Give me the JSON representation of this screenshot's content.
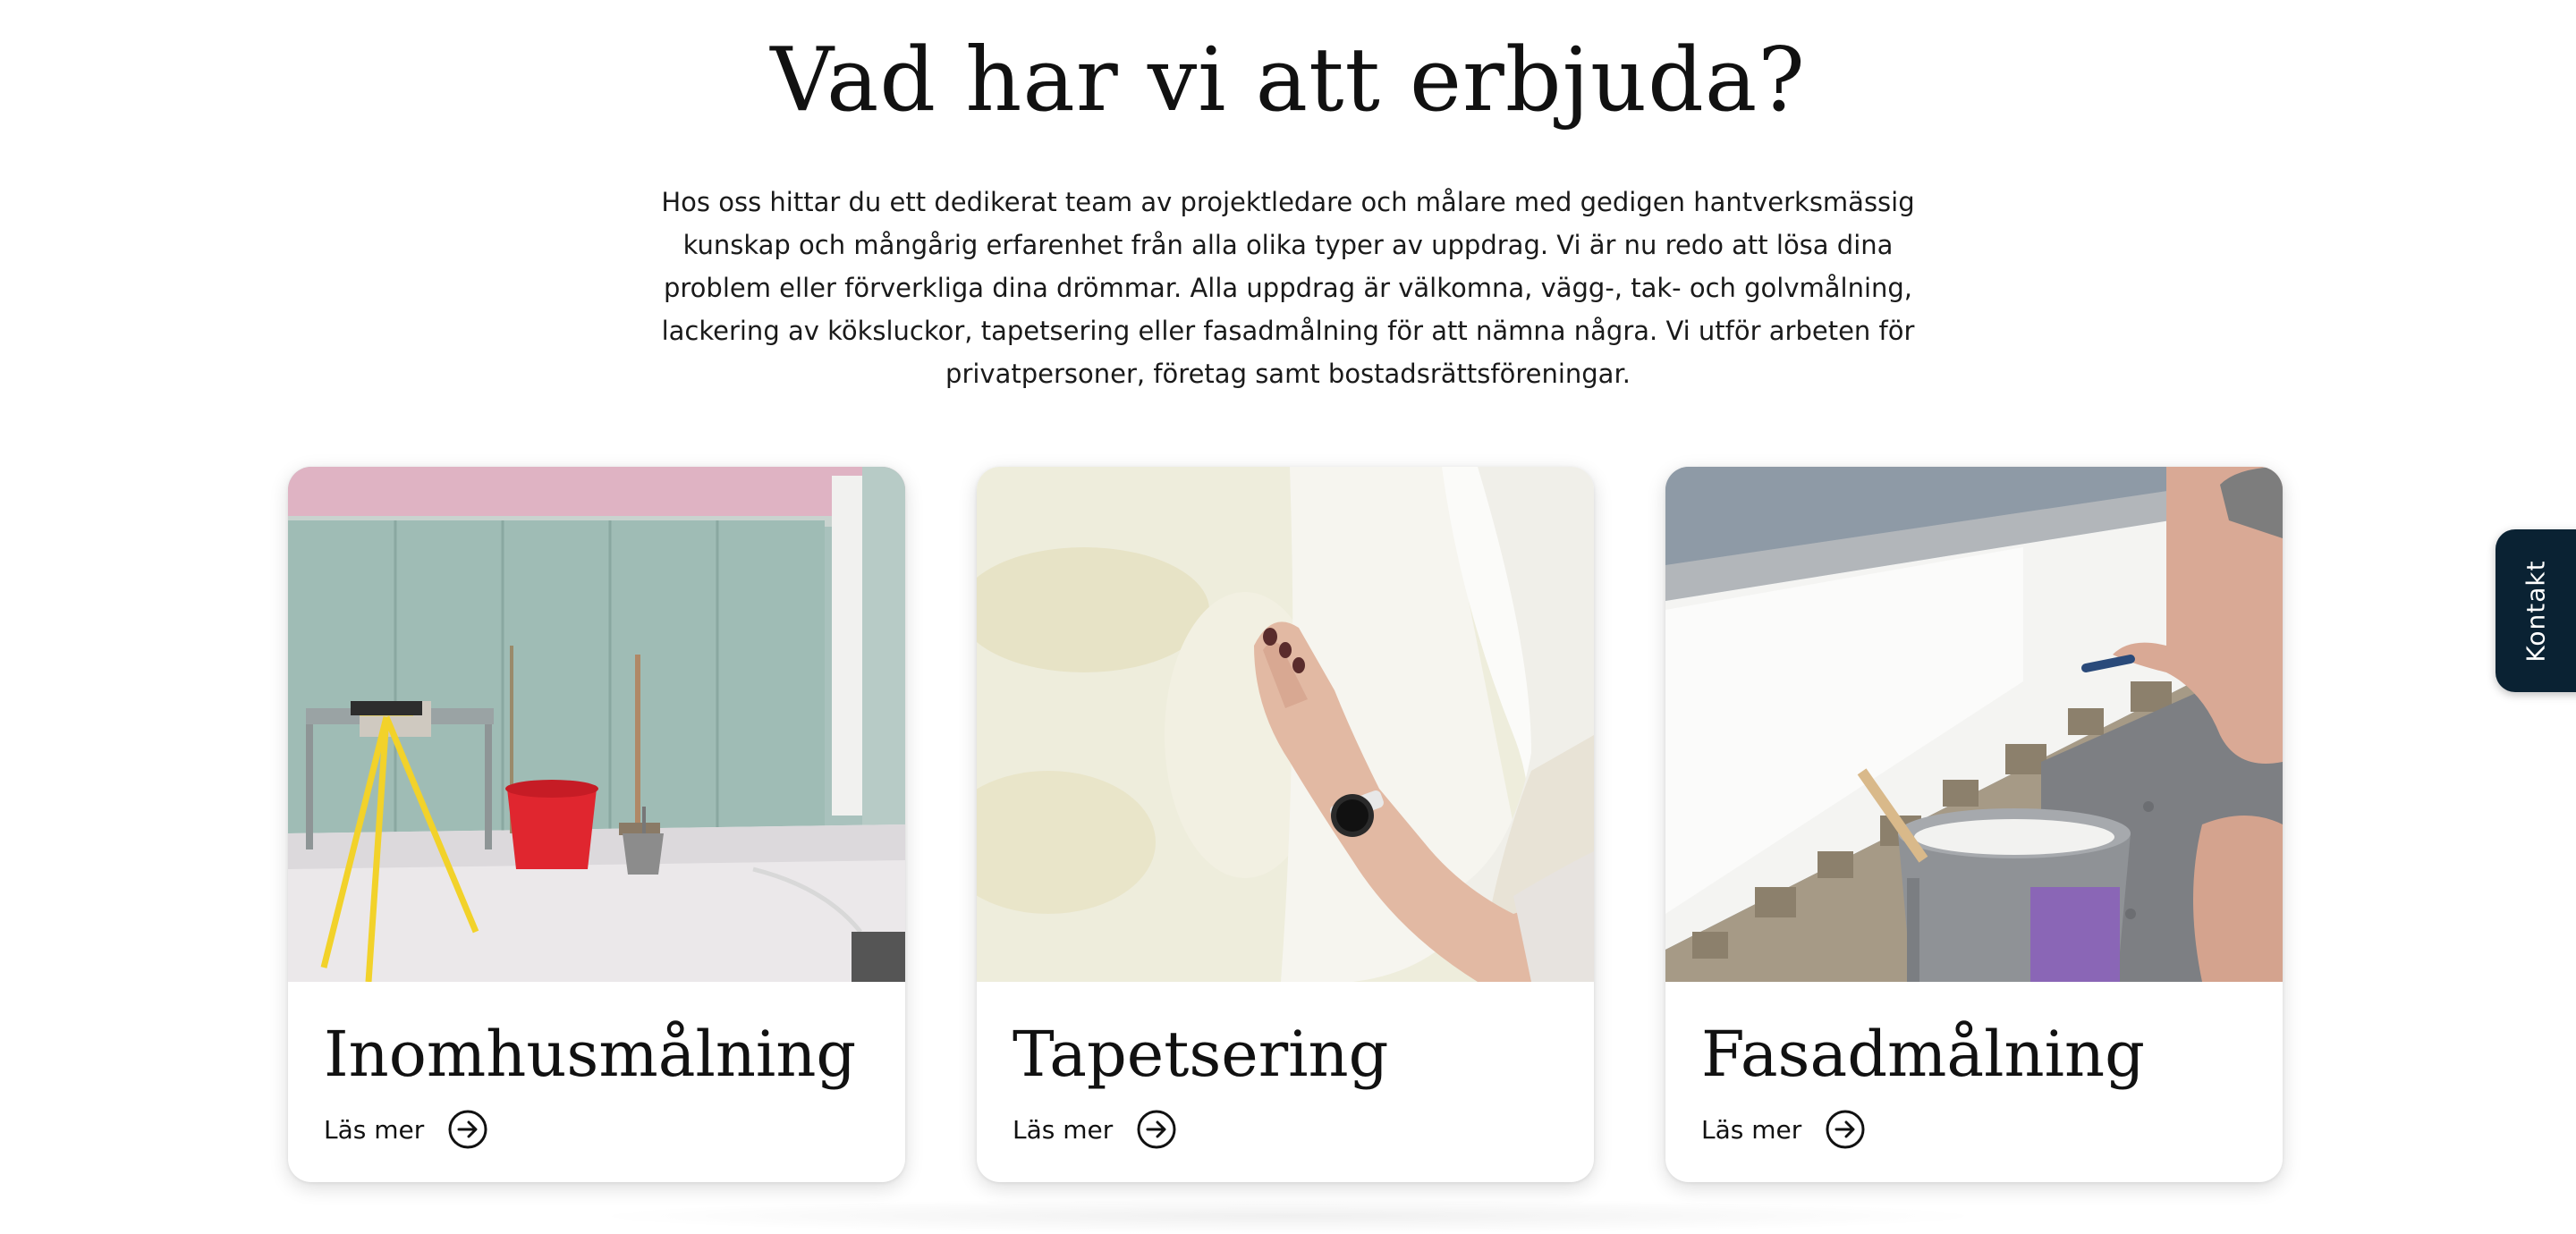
{
  "section": {
    "heading": "Vad har vi att erbjuda?",
    "intro": "Hos oss hittar du ett dedikerat team av projektledare och målare med gedigen hantverksmässig kunskap och mångårig erfarenhet från alla olika typer av uppdrag. Vi är nu redo att lösa dina problem eller förverkliga dina drömmar. Alla uppdrag är välkomna, vägg-, tak- och golvmålning, lackering av köksluckor, tapetsering eller fasadmålning för att nämna några. Vi utför arbeten för privatpersoner, företag samt bostadsrättsföreningar."
  },
  "cards": [
    {
      "title": "Inomhusmålning",
      "link_label": "Läs mer",
      "icon": "arrow-right-circle-icon"
    },
    {
      "title": "Tapetsering",
      "link_label": "Läs mer",
      "icon": "arrow-right-circle-icon"
    },
    {
      "title": "Fasadmålning",
      "link_label": "Läs mer",
      "icon": "arrow-right-circle-icon"
    }
  ],
  "side_tab": {
    "label": "Kontakt",
    "color": "#0a2233"
  }
}
